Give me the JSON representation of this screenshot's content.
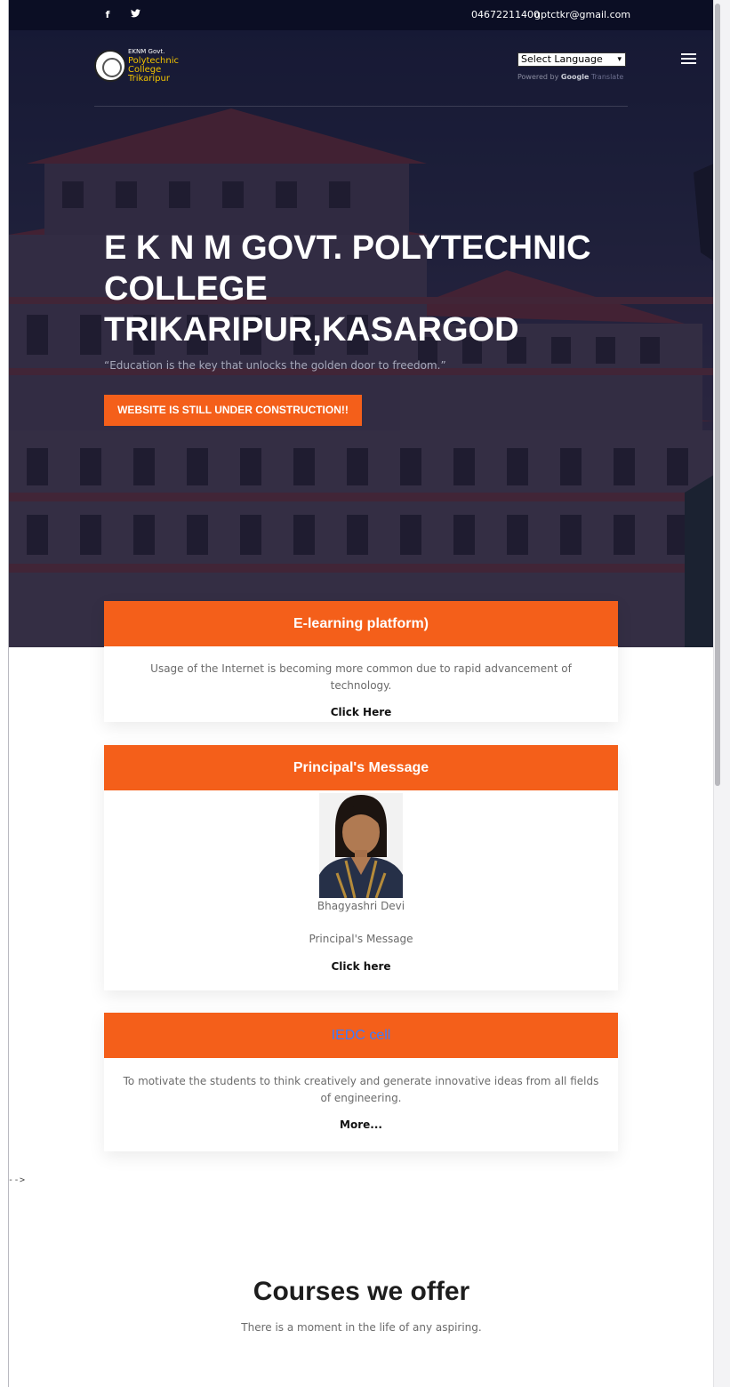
{
  "topbar": {
    "facebook_icon": "facebook-icon",
    "twitter_icon": "twitter-icon",
    "phone": "04672211400",
    "email": "gptctkr@gmail.com"
  },
  "logo": {
    "line1": "EKNM Govt.",
    "line2": "Polytechnic",
    "line3": "College",
    "line4": "Trikaripur"
  },
  "language": {
    "select_label": "Select Language",
    "powered_prefix": "Powered by",
    "google": "Google",
    "translate": "Translate"
  },
  "hero": {
    "title_line1": "E K N M GOVT. POLYTECHNIC",
    "title_line2": "COLLEGE",
    "title_line3": "TRIKARIPUR,KASARGOD",
    "quote": "“Education is the key that unlocks the golden door to freedom.”",
    "button": "WEBSITE IS STILL UNDER CONSTRUCTION!!"
  },
  "cards": {
    "elearning": {
      "title": "E-learning platform)",
      "text": "Usage of the Internet is becoming more common due to rapid advancement of technology.",
      "link": "Click Here"
    },
    "principal": {
      "title": "Principal's Message",
      "name": "Bhagyashri Devi",
      "text": "Principal's Message",
      "link": "Click here"
    },
    "iedc": {
      "title": "IEDC cell",
      "text": "To motivate the students to think creatively and generate innovative ideas from all fields of engineering.",
      "link": "More..."
    }
  },
  "stray_comment": "-->",
  "courses": {
    "title": "Courses we offer",
    "subtitle": "There is a moment in the life of any aspiring."
  },
  "colors": {
    "accent": "#f45f1a",
    "topbar": "#0b0e24",
    "link_blue": "#3a7bff"
  }
}
